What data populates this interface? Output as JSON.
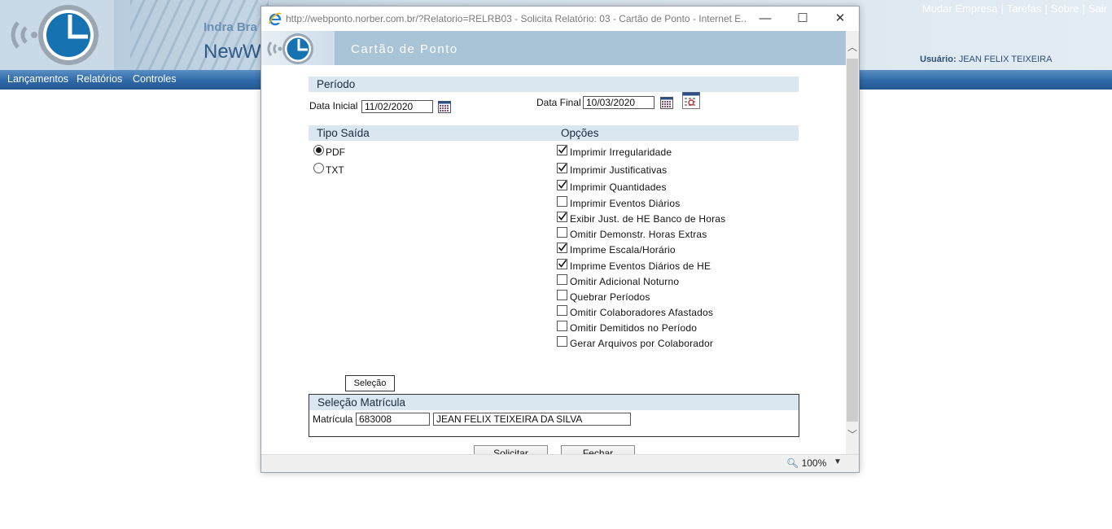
{
  "app": {
    "brand_top": "Indra Bra",
    "brand_main": "NewW",
    "top_links": [
      "Mudar Empresa",
      "Tarefas",
      "Sobre",
      "Sair"
    ],
    "user_label": "Usuário:",
    "user_name": "JEAN FELIX TEIXEIRA",
    "menu": [
      "Lançamentos",
      "Relatórios",
      "Controles"
    ]
  },
  "window": {
    "title": "http://webponto.norber.com.br/?Relatorio=RELRB03 - Solicita Relatório: 03 - Cartão de Ponto - Internet E...",
    "minimize": "—",
    "maximize": "☐",
    "close": "✕",
    "zoom": "100%",
    "icon": "ie-icon"
  },
  "form": {
    "title": "Cartão de Ponto",
    "periodo": {
      "header": "Período",
      "data_inicial_label": "Data Inicial",
      "data_inicial": "11/02/2020",
      "data_final_label": "Data Final",
      "data_final": "10/03/2020"
    },
    "tipo_saida": {
      "header": "Tipo Saída",
      "options": [
        "PDF",
        "TXT"
      ],
      "selected": "PDF"
    },
    "opcoes": {
      "header": "Opções",
      "items": [
        {
          "label": "Imprimir Irregularidade",
          "checked": true
        },
        {
          "label": "Imprimir Justificativas",
          "checked": true
        },
        {
          "label": "Imprimir Quantidades",
          "checked": true
        },
        {
          "label": "Imprimir Eventos Diários",
          "checked": false
        },
        {
          "label": "Exibir Just. de HE Banco de Horas",
          "checked": true
        },
        {
          "label": "Omitir Demonstr. Horas Extras",
          "checked": false
        },
        {
          "label": "Imprime Escala/Horário",
          "checked": true
        },
        {
          "label": "Imprime Eventos Diários de HE",
          "checked": true
        },
        {
          "label": "Omitir Adicional Noturno",
          "checked": false
        },
        {
          "label": "Quebrar Períodos",
          "checked": false
        },
        {
          "label": "Omitir Colaboradores Afastados",
          "checked": false
        },
        {
          "label": "Omitir Demitidos no Período",
          "checked": false
        },
        {
          "label": "Gerar Arquivos por Colaborador",
          "checked": false
        }
      ]
    },
    "selecao_button": "Seleção",
    "selecao_matricula": {
      "header": "Seleção Matrícula",
      "matricula_label": "Matrícula",
      "matricula": "683008",
      "nome": "JEAN FELIX TEIXEIRA DA SILVA"
    },
    "solicitar": "Solicitar",
    "fechar": "Fechar"
  }
}
